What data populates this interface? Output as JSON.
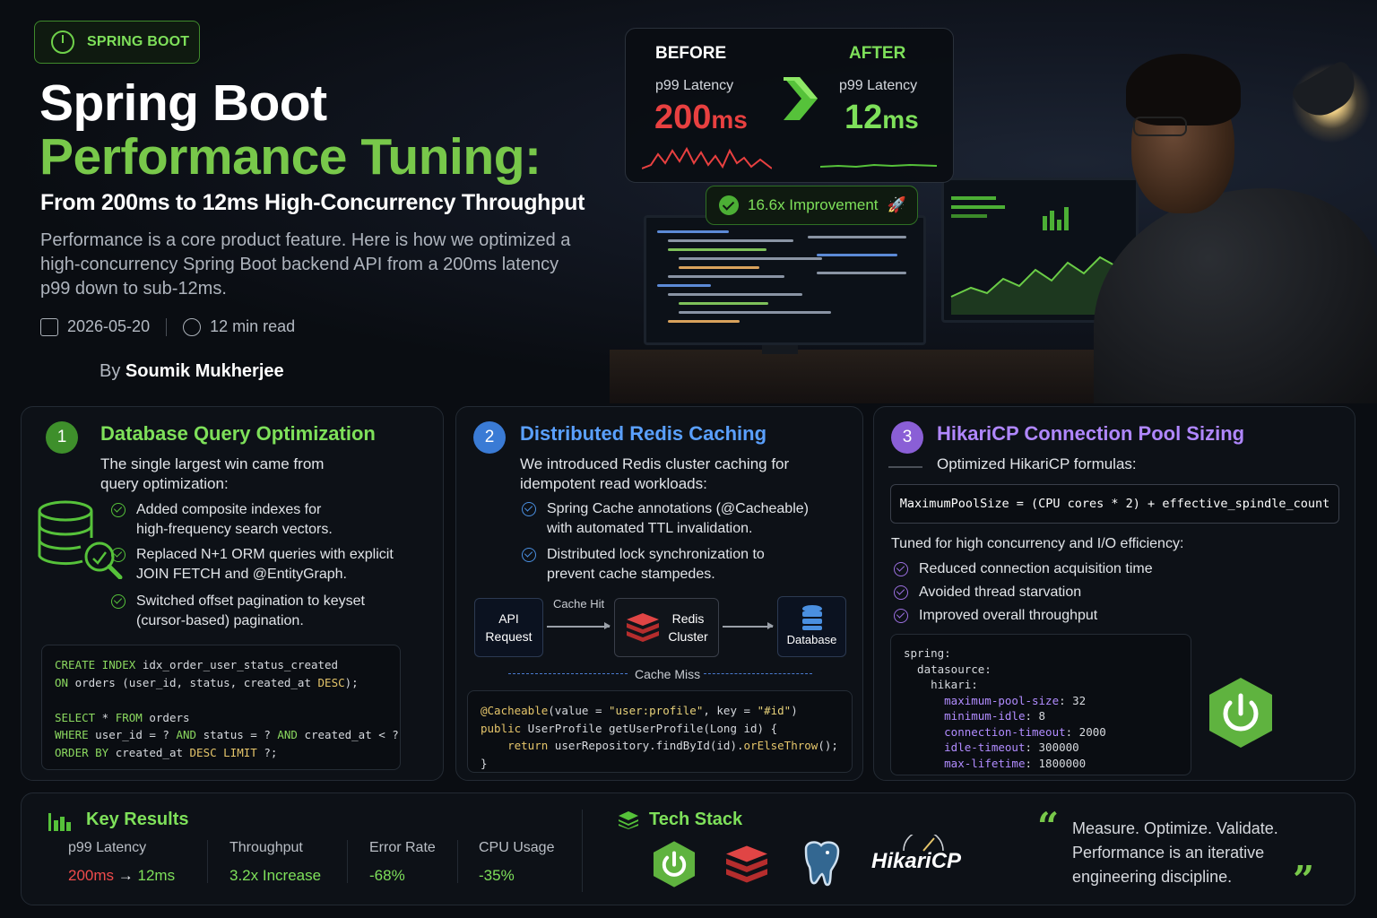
{
  "badge": {
    "label": "SPRING BOOT",
    "icon": "power-icon"
  },
  "header": {
    "title_line1": "Spring Boot",
    "title_line2": "Performance Tuning:",
    "subtitle": "From 200ms to 12ms High-Concurrency Throughput",
    "intro": "Performance is a core product feature. Here is how we optimized a high-concurrency Spring Boot backend API from a 200ms latency p99 down to sub-12ms.",
    "date": "2026-05-20",
    "read_time": "12 min read",
    "by": "By",
    "author": "Soumik Mukherjee"
  },
  "before_after": {
    "before_label": "BEFORE",
    "before_metric": "p99 Latency",
    "before_value": "200",
    "before_unit": "ms",
    "after_label": "AFTER",
    "after_metric": "p99 Latency",
    "after_value": "12",
    "after_unit": "ms",
    "improvement": "16.6x Improvement",
    "rocket_icon": "🚀"
  },
  "section1": {
    "number": "1",
    "title": "Database Query Optimization",
    "description": "The single largest win came from query optimization:",
    "bullets": [
      "Added composite indexes for high-frequency search vectors.",
      "Replaced N+1 ORM queries with explicit JOIN FETCH and @EntityGraph.",
      "Switched offset pagination to keyset (cursor-based) pagination."
    ],
    "icon": "database-search-icon"
  },
  "section2": {
    "number": "2",
    "title": "Distributed Redis Caching",
    "description": "We introduced Redis cluster caching for idempotent read workloads:",
    "bullets": [
      "Spring Cache annotations (@Cacheable) with automated TTL invalidation.",
      "Distributed lock synchronization to prevent cache stampedes."
    ],
    "flow": {
      "api": [
        "API",
        "Request"
      ],
      "redis": [
        "Redis",
        "Cluster"
      ],
      "db": "Database",
      "hit": "Cache Hit",
      "miss": "Cache Miss"
    }
  },
  "section3": {
    "number": "3",
    "title": "HikariCP Connection Pool Sizing",
    "description": "Optimized HikariCP formulas:",
    "formula": "MaximumPoolSize = (CPU cores * 2) + effective_spindle_count",
    "tuned": "Tuned for high concurrency and I/O efficiency:",
    "bullets": [
      "Reduced connection acquisition time",
      "Avoided thread starvation",
      "Improved overall throughput"
    ]
  },
  "key_results": {
    "title": "Key Results",
    "metrics": [
      {
        "label": "p99 Latency",
        "from": "200ms",
        "arrow": "→",
        "to": "12ms"
      },
      {
        "label": "Throughput",
        "value": "3.2x Increase"
      },
      {
        "label": "Error Rate",
        "value": "-68%"
      },
      {
        "label": "CPU Usage",
        "value": "-35%"
      }
    ]
  },
  "tech_stack": {
    "title": "Tech Stack",
    "items": [
      "spring-boot-icon",
      "redis-icon",
      "postgresql-icon",
      "HikariCP"
    ]
  },
  "quote": "Measure. Optimize. Validate. Performance is an iterative engineering discipline.",
  "colors": {
    "green": "#78c84a",
    "blue": "#4a8fe0",
    "purple": "#9b6fe0",
    "red": "#e04545"
  }
}
